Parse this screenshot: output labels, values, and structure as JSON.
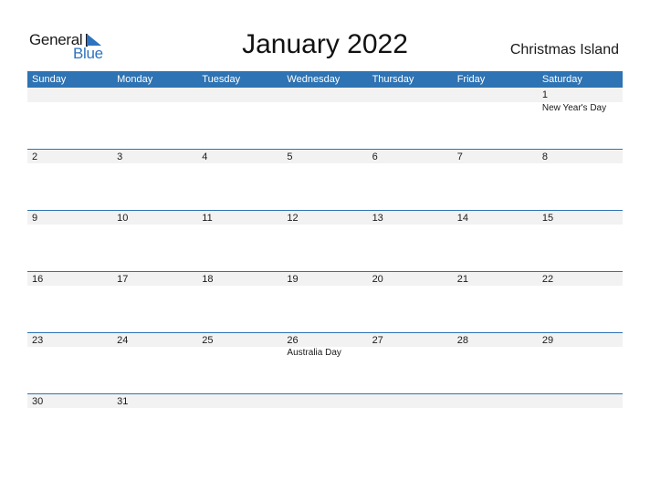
{
  "logo": {
    "line1": "General",
    "line2": "Blue",
    "brand_color": "#2e73c0"
  },
  "header": {
    "title": "January 2022",
    "region": "Christmas Island"
  },
  "weekdays": [
    "Sunday",
    "Monday",
    "Tuesday",
    "Wednesday",
    "Thursday",
    "Friday",
    "Saturday"
  ],
  "weeks": [
    [
      {
        "day": ""
      },
      {
        "day": ""
      },
      {
        "day": ""
      },
      {
        "day": ""
      },
      {
        "day": ""
      },
      {
        "day": ""
      },
      {
        "day": "1",
        "holiday": "New Year's Day"
      }
    ],
    [
      {
        "day": "2"
      },
      {
        "day": "3"
      },
      {
        "day": "4"
      },
      {
        "day": "5"
      },
      {
        "day": "6"
      },
      {
        "day": "7"
      },
      {
        "day": "8"
      }
    ],
    [
      {
        "day": "9"
      },
      {
        "day": "10"
      },
      {
        "day": "11"
      },
      {
        "day": "12"
      },
      {
        "day": "13"
      },
      {
        "day": "14"
      },
      {
        "day": "15"
      }
    ],
    [
      {
        "day": "16"
      },
      {
        "day": "17"
      },
      {
        "day": "18"
      },
      {
        "day": "19"
      },
      {
        "day": "20"
      },
      {
        "day": "21"
      },
      {
        "day": "22"
      }
    ],
    [
      {
        "day": "23"
      },
      {
        "day": "24"
      },
      {
        "day": "25"
      },
      {
        "day": "26",
        "holiday": "Australia Day"
      },
      {
        "day": "27"
      },
      {
        "day": "28"
      },
      {
        "day": "29"
      }
    ],
    [
      {
        "day": "30"
      },
      {
        "day": "31"
      },
      {
        "day": ""
      },
      {
        "day": ""
      },
      {
        "day": ""
      },
      {
        "day": ""
      },
      {
        "day": ""
      }
    ]
  ],
  "colors": {
    "header_bg": "#2e73b3",
    "date_band": "#f2f2f2",
    "week_divider": "#2e73b3"
  }
}
